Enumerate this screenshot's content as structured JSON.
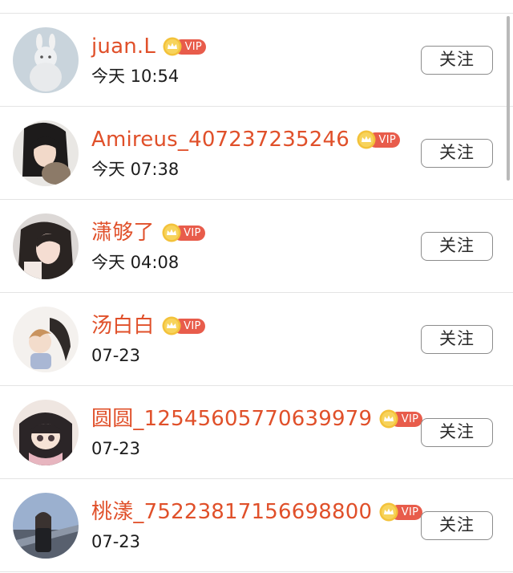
{
  "follow_label": "关注",
  "vip_label": "VIP",
  "colors": {
    "name": "#e0502a",
    "vip_badge": "#e85c4b",
    "vip_coin": "#f3c23a",
    "divider": "#e4e4e4"
  },
  "users": [
    {
      "name": "juan.L",
      "time": "今天 10:54",
      "vip": true
    },
    {
      "name": "Amireus_407237235246",
      "time": "今天 07:38",
      "vip": true
    },
    {
      "name": "潇够了",
      "time": "今天 04:08",
      "vip": true
    },
    {
      "name": "汤白白",
      "time": "07-23",
      "vip": true
    },
    {
      "name": "圆圆_12545605770639979",
      "time": "07-23",
      "vip": true
    },
    {
      "name": "桃漾_7522381715669880​0",
      "time": "07-23",
      "vip": true
    }
  ]
}
